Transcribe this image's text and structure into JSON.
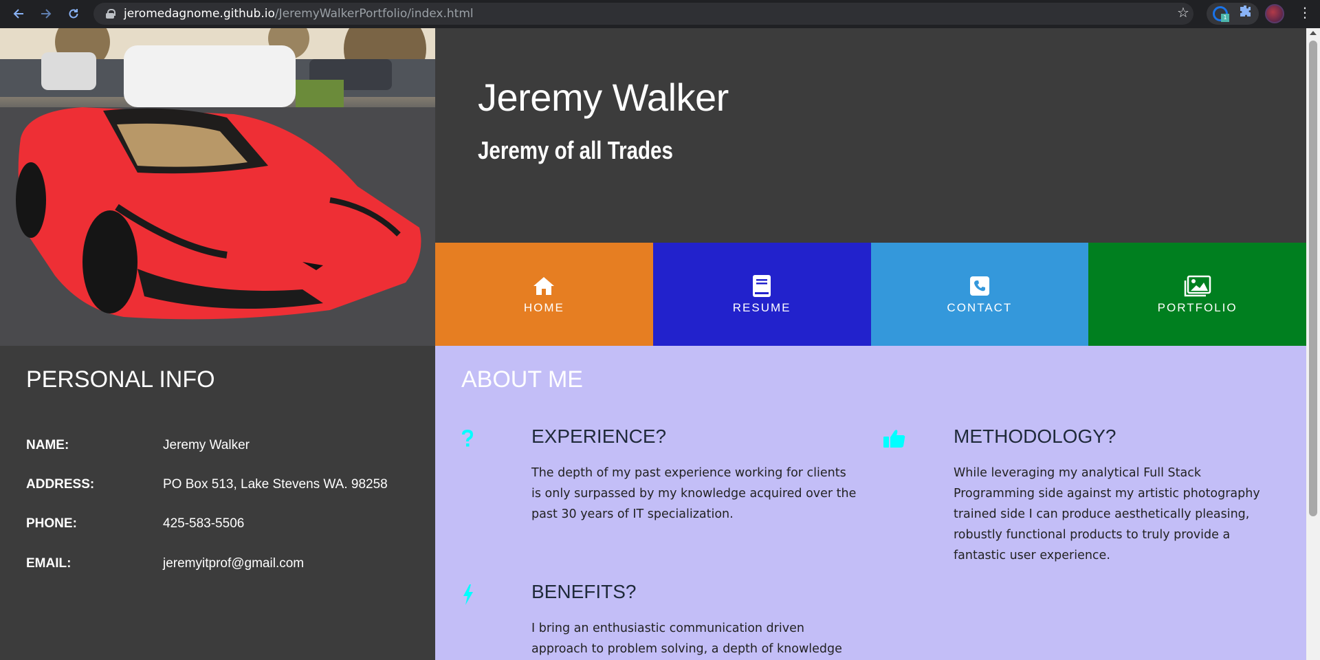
{
  "browser": {
    "url_host": "jeromedagnome.github.io",
    "url_path": "/JeremyWalkerPortfolio/index.html",
    "extension_badge": "1"
  },
  "header": {
    "title": "Jeremy Walker",
    "subtitle": "Jeremy of all Trades"
  },
  "nav": [
    {
      "label": "HOME",
      "color": "#e67e22",
      "icon": "home-icon"
    },
    {
      "label": "RESUME",
      "color": "#2222cc",
      "icon": "book-icon"
    },
    {
      "label": "CONTACT",
      "color": "#3498db",
      "icon": "phone-icon"
    },
    {
      "label": "PORTFOLIO",
      "color": "#007f1f",
      "icon": "images-icon"
    }
  ],
  "personal": {
    "title": "PERSONAL INFO",
    "rows": [
      {
        "label": "NAME:",
        "value": "Jeremy Walker"
      },
      {
        "label": "ADDRESS:",
        "value": "PO Box 513, Lake Stevens WA. 98258"
      },
      {
        "label": "PHONE:",
        "value": "425-583-5506"
      },
      {
        "label": "EMAIL:",
        "value": "jeremyitprof@gmail.com"
      }
    ]
  },
  "about": {
    "title": "ABOUT ME",
    "features": [
      {
        "icon": "question-icon",
        "title": "EXPERIENCE?",
        "lines": [
          "The depth of my past experience working for clients",
          "is only surpassed by my knowledge acquired over the",
          "past 30 years of IT specialization."
        ]
      },
      {
        "icon": "thumbs-up-icon",
        "title": "METHODOLOGY?",
        "lines": [
          "While leveraging my analytical Full Stack",
          "Programming side against my artistic photography",
          "trained side I can produce aesthetically pleasing,",
          "robustly functional products to truly provide a",
          "fantastic user experience."
        ]
      },
      {
        "icon": "bolt-icon",
        "title": "BENEFITS?",
        "lines": [
          "I bring an enthusiastic communication driven",
          "approach to problem solving, a depth of knowledge"
        ]
      }
    ],
    "accent_color": "#00ffff",
    "background": "#c3bef7"
  }
}
